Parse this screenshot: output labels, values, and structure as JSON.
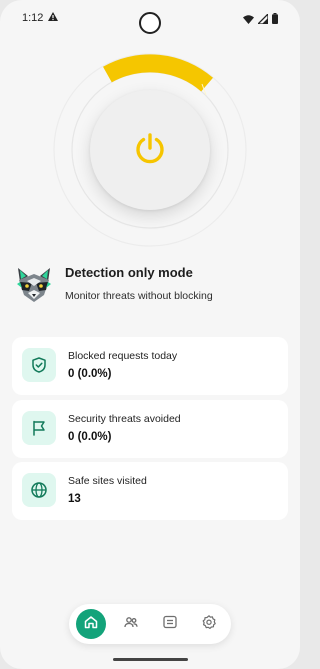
{
  "status_bar": {
    "time": "1:12",
    "icons": [
      "alert-icon",
      "wifi-icon",
      "signal-icon",
      "battery-icon"
    ]
  },
  "power": {
    "icon": "power-icon",
    "accent_color": "#f6c500",
    "arc_color": "#f5c600"
  },
  "mode": {
    "mascot": "raccoon-mascot",
    "title": "Detection only mode",
    "subtitle": "Monitor threats without blocking"
  },
  "stats": [
    {
      "icon": "shield-check-icon",
      "label": "Blocked requests today",
      "value": "0 (0.0%)"
    },
    {
      "icon": "flag-icon",
      "label": "Security threats avoided",
      "value": "0 (0.0%)"
    },
    {
      "icon": "globe-icon",
      "label": "Safe sites visited",
      "value": "13"
    }
  ],
  "nav": {
    "items": [
      {
        "icon": "home-icon",
        "active": true
      },
      {
        "icon": "people-icon",
        "active": false
      },
      {
        "icon": "checklist-icon",
        "active": false
      },
      {
        "icon": "settings-icon",
        "active": false
      }
    ],
    "active_color": "#13a37a"
  },
  "colors": {
    "card_icon_bg": "#dff7ef",
    "card_icon_fg": "#127a5a",
    "background": "#f6f6f6"
  }
}
